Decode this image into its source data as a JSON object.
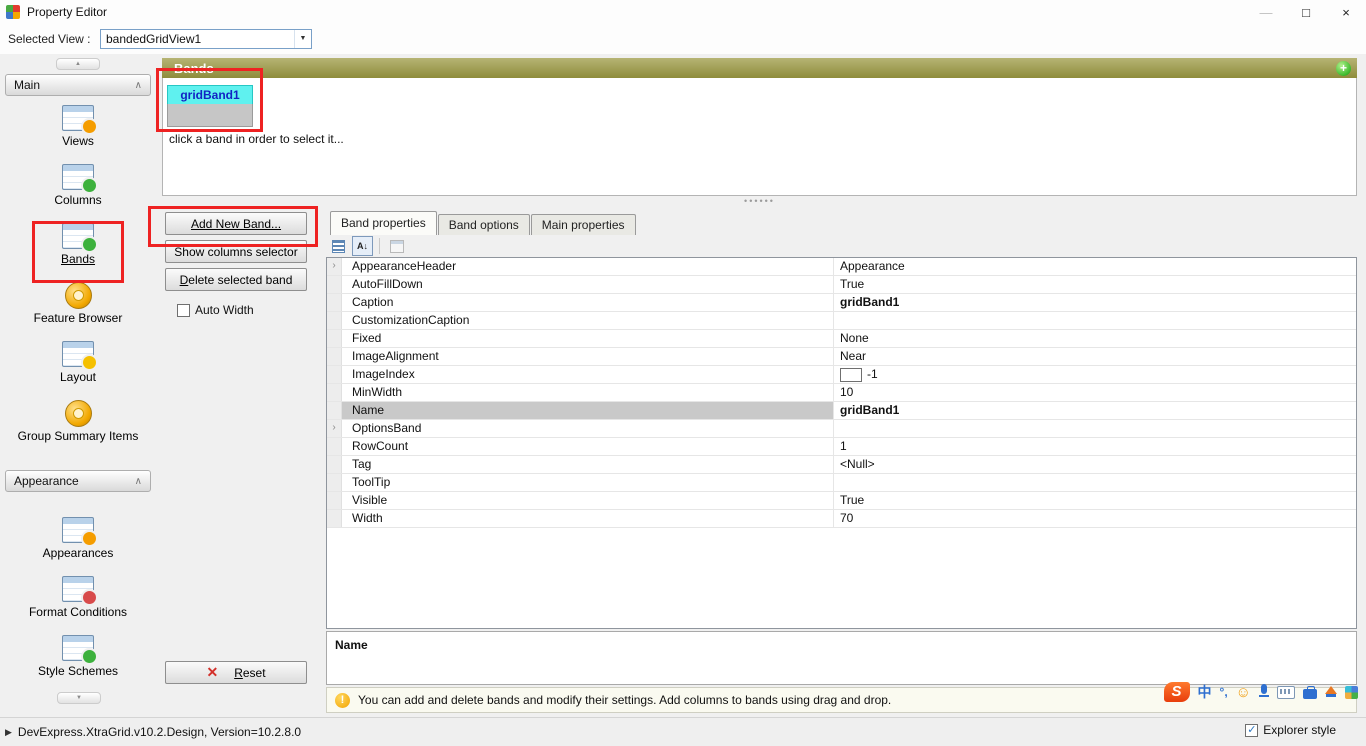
{
  "colors": {
    "annotation_red": "#ee2222",
    "band_header_top": "#b6b474",
    "band_header_bottom": "#8e8c3b",
    "band_selected_cyan": "#5ff1ef"
  },
  "window": {
    "title": "Property Editor",
    "minimize_glyph": "—",
    "maximize_glyph": "□",
    "close_glyph": "×"
  },
  "view_selector": {
    "label": "Selected View :",
    "value": "bandedGridView1",
    "arrow": "▼"
  },
  "sidebar": {
    "groups": [
      {
        "label": "Main",
        "items": [
          {
            "label": "Views",
            "icon": "views-icon",
            "badge": "#f59d00"
          },
          {
            "label": "Columns",
            "icon": "columns-icon",
            "badge": "#3db13d"
          },
          {
            "label": "Bands",
            "icon": "bands-icon",
            "badge": "#3db13d",
            "selected": true
          },
          {
            "label": "Feature Browser",
            "icon": "feature-browser-icon",
            "round": true
          },
          {
            "label": "Layout",
            "icon": "layout-icon",
            "badge": "#f5c000"
          },
          {
            "label": "Group Summary Items",
            "icon": "group-summary-items-icon",
            "round": true
          }
        ]
      },
      {
        "label": "Appearance",
        "items": [
          {
            "label": "Appearances",
            "icon": "appearances-icon",
            "badge": "#f59d00"
          },
          {
            "label": "Format Conditions",
            "icon": "format-conditions-icon",
            "badge": "#d84b4b"
          },
          {
            "label": "Style Schemes",
            "icon": "style-schemes-icon",
            "badge": "#3db13d"
          }
        ]
      }
    ]
  },
  "bands_panel": {
    "title": "Bands",
    "add_glyph": "+",
    "band_label": "gridBand1",
    "hint": "click a band in order to select it..."
  },
  "actions": {
    "add_new_band": "Add New Band...",
    "show_columns_selector": "Show columns selector",
    "delete_selected_band": "Delete selected band",
    "auto_width_label": "Auto Width",
    "auto_width_checked": false,
    "reset_label": "Reset"
  },
  "tabs": [
    {
      "label": "Band properties",
      "active": true
    },
    {
      "label": "Band options",
      "active": false
    },
    {
      "label": "Main properties",
      "active": false
    }
  ],
  "property_grid": {
    "toolbar": {
      "categorized": "categorized-icon",
      "alphabetical": "alphabetical-icon",
      "alphabetical_glyph": "A↓",
      "property_pages": "property-pages-icon"
    },
    "rows": [
      {
        "name": "AppearanceHeader",
        "value": "Appearance",
        "expandable": true
      },
      {
        "name": "AutoFillDown",
        "value": "True"
      },
      {
        "name": "Caption",
        "value": "gridBand1",
        "bold": true
      },
      {
        "name": "CustomizationCaption",
        "value": ""
      },
      {
        "name": "Fixed",
        "value": "None"
      },
      {
        "name": "ImageAlignment",
        "value": "Near"
      },
      {
        "name": "ImageIndex",
        "value": "-1",
        "image_box": true
      },
      {
        "name": "MinWidth",
        "value": "10"
      },
      {
        "name": "Name",
        "value": "gridBand1",
        "bold": true,
        "selected": true
      },
      {
        "name": "OptionsBand",
        "value": "",
        "expandable": true
      },
      {
        "name": "RowCount",
        "value": "1"
      },
      {
        "name": "Tag",
        "value": "<Null>"
      },
      {
        "name": "ToolTip",
        "value": ""
      },
      {
        "name": "Visible",
        "value": "True"
      },
      {
        "name": "Width",
        "value": "70"
      }
    ],
    "description_title": "Name"
  },
  "info_bar": {
    "icon_glyph": "!",
    "text": "You can add and delete bands and modify their settings. Add columns to bands using drag and drop."
  },
  "tray": [
    {
      "name": "sogou-logo-icon",
      "glyph": "S"
    },
    {
      "name": "chinese-mode-icon",
      "glyph": "中"
    },
    {
      "name": "punctuation-icon",
      "glyph": "°,"
    },
    {
      "name": "emoji-icon",
      "glyph": "☺"
    },
    {
      "name": "mic-icon"
    },
    {
      "name": "keyboard-icon"
    },
    {
      "name": "toolbox-icon"
    },
    {
      "name": "skin-icon"
    },
    {
      "name": "menu-grid-icon"
    }
  ],
  "status_bar": {
    "arrow_glyph": "▶",
    "text": "DevExpress.XtraGrid.v10.2.Design, Version=10.2.8.0",
    "explorer_style_label": "Explorer style",
    "explorer_style_checked": true
  }
}
